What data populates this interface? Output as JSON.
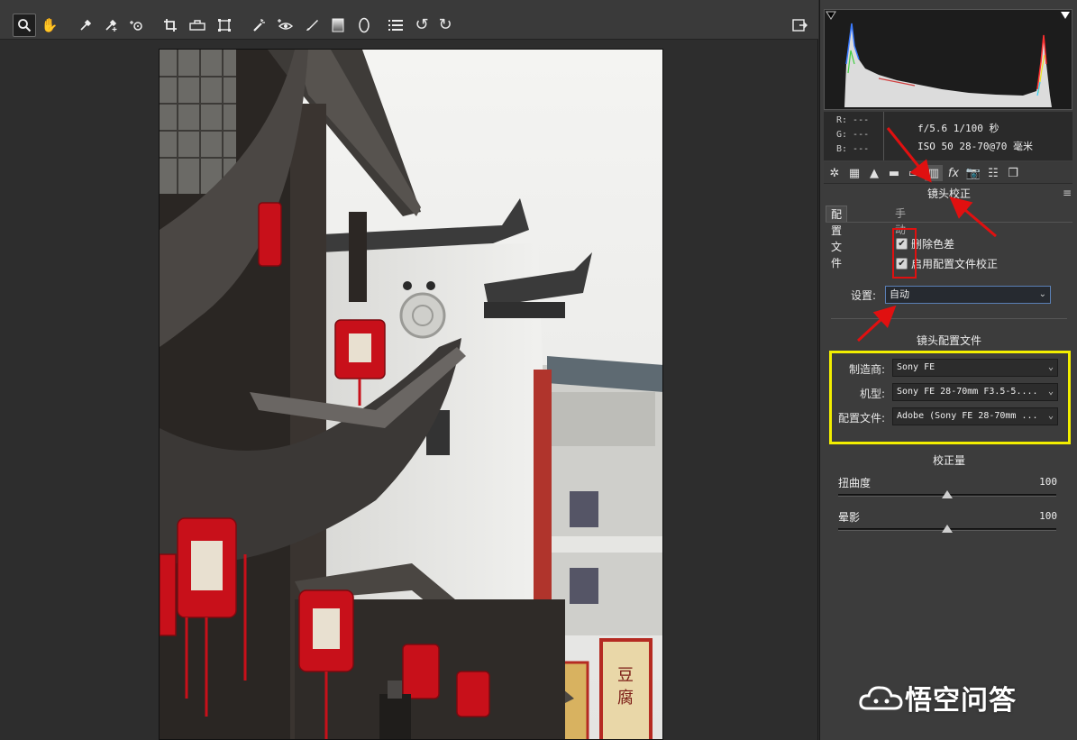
{
  "toolbar": {
    "tools": [
      {
        "name": "zoom-tool",
        "icon": "magnifier-icon",
        "glyph": "🔍"
      },
      {
        "name": "hand-tool",
        "icon": "hand-icon",
        "glyph": "✋"
      },
      {
        "name": "white-balance-tool",
        "icon": "eyedropper-icon",
        "glyph": "⚲"
      },
      {
        "name": "color-sampler-tool",
        "icon": "eyedropper-plus-icon",
        "glyph": "⚲"
      },
      {
        "name": "targeted-adjustment-tool",
        "icon": "target-icon",
        "glyph": "◎"
      },
      {
        "name": "crop-tool",
        "icon": "crop-icon",
        "glyph": "⌗"
      },
      {
        "name": "straighten-tool",
        "icon": "level-icon",
        "glyph": "⊟"
      },
      {
        "name": "transform-tool",
        "icon": "transform-icon",
        "glyph": "⬚"
      },
      {
        "name": "spot-removal-tool",
        "icon": "brush-spot-icon",
        "glyph": "✎"
      },
      {
        "name": "red-eye-tool",
        "icon": "eye-plus-icon",
        "glyph": "⊙"
      },
      {
        "name": "adjustment-brush-tool",
        "icon": "brush-icon",
        "glyph": "✐"
      },
      {
        "name": "graduated-filter-tool",
        "icon": "gradient-icon",
        "glyph": "▤"
      },
      {
        "name": "radial-filter-tool",
        "icon": "ellipse-icon",
        "glyph": "◯"
      },
      {
        "name": "preferences-tool",
        "icon": "list-icon",
        "glyph": "☰"
      },
      {
        "name": "rotate-ccw-tool",
        "icon": "rotate-left-icon",
        "glyph": "↺"
      },
      {
        "name": "rotate-cw-tool",
        "icon": "rotate-right-icon",
        "glyph": "↻"
      }
    ],
    "fullscreen_icon": "⇱"
  },
  "info": {
    "r_label": "R: ---",
    "g_label": "G: ---",
    "b_label": "B: ---",
    "exposure": "f/5.6  1/100 秒",
    "iso_lens": "ISO 50  28-70@70 毫米"
  },
  "panel_tabs": [
    {
      "name": "basic",
      "glyph": "✲"
    },
    {
      "name": "tone-curve",
      "glyph": "▦"
    },
    {
      "name": "detail",
      "glyph": "▲"
    },
    {
      "name": "hsl",
      "glyph": "▬"
    },
    {
      "name": "split-toning",
      "glyph": "▭"
    },
    {
      "name": "lens-corrections",
      "glyph": "▥"
    },
    {
      "name": "effects",
      "glyph": "fx"
    },
    {
      "name": "camera-calibration",
      "glyph": "📷"
    },
    {
      "name": "presets",
      "glyph": "☷"
    },
    {
      "name": "snapshots",
      "glyph": "❐"
    }
  ],
  "lens": {
    "title": "镜头校正",
    "menu_glyph": "≡",
    "subtabs": [
      "配置文件",
      "手动"
    ],
    "checkbox1": "删除色差",
    "checkbox2": "启用配置文件校正",
    "check_glyph": "✔",
    "settings_label": "设置:",
    "settings_value": "自动",
    "profile_title": "镜头配置文件",
    "make_label": "制造商:",
    "make_value": "Sony FE",
    "model_label": "机型:",
    "model_value": "Sony FE 28-70mm F3.5-5....",
    "profile_label": "配置文件:",
    "profile_value": "Adobe (Sony FE 28-70mm ...",
    "amount_title": "校正量",
    "distortion_label": "扭曲度",
    "distortion_value": "100",
    "vignette_label": "晕影",
    "vignette_value": "100",
    "chevron": "⌄"
  },
  "sliders": {
    "distortion_fraction": 0.5,
    "vignette_fraction": 0.5
  },
  "watermark": {
    "text": "悟空问答"
  },
  "colors": {
    "annotation_red": "#e01010",
    "annotation_yellow": "#f2ee00",
    "lantern_red": "#c8101a"
  }
}
